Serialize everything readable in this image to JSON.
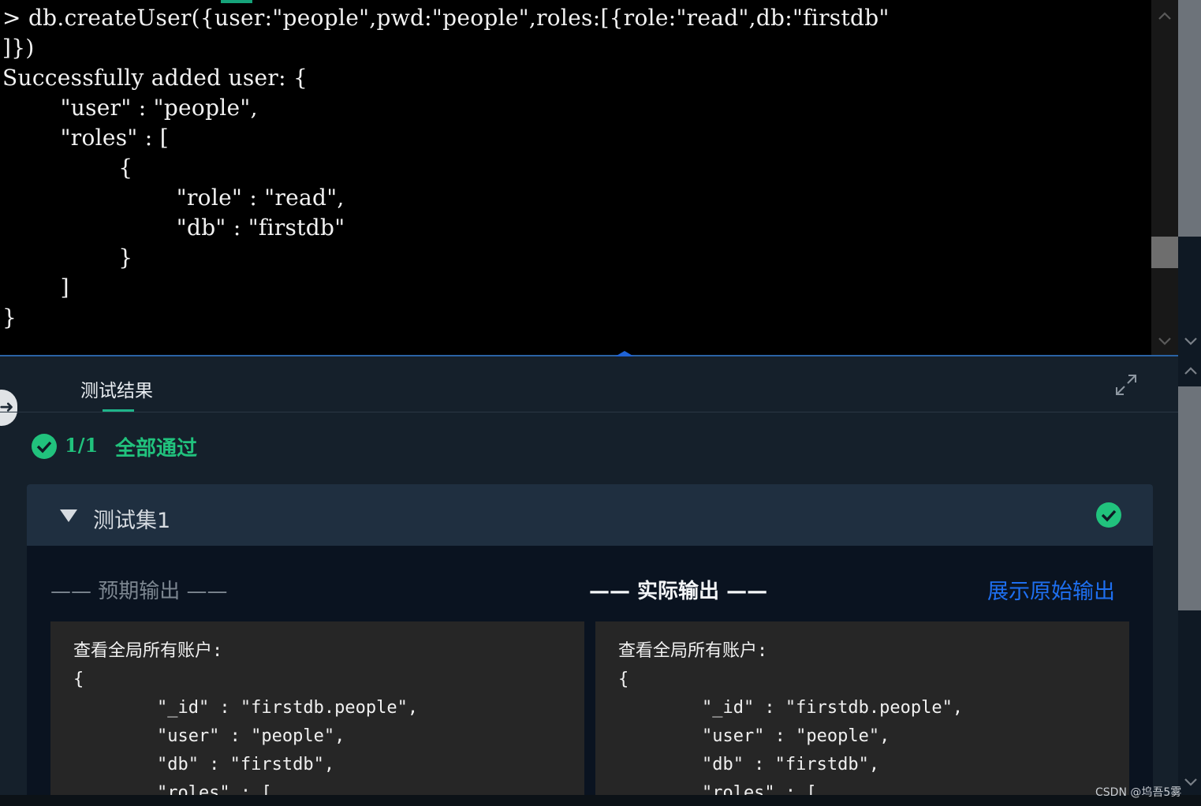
{
  "terminal": {
    "lines": [
      "> db.createUser({user:\"people\",pwd:\"people\",roles:[{role:\"read\",db:\"firstdb\"",
      "]})",
      "Successfully added user: {",
      "        \"user\" : \"people\",",
      "        \"roles\" : [",
      "                {",
      "                        \"role\" : \"read\",",
      "                        \"db\" : \"firstdb\"",
      "                }",
      "        ]",
      "}"
    ]
  },
  "results": {
    "tab_label": "测试结果",
    "summary": {
      "count": "1/1",
      "status": "全部通过"
    },
    "suite": {
      "title": "测试集1",
      "expected_label": "—— 预期输出 ——",
      "actual_label": "—— 实际输出 ——",
      "raw_output_link": "展示原始输出",
      "expected_lines": [
        "查看全局所有账户:",
        "{",
        "        \"_id\" : \"firstdb.people\",",
        "        \"user\" : \"people\",",
        "        \"db\" : \"firstdb\",",
        "        \"roles\" : ["
      ],
      "actual_lines": [
        "查看全局所有账户:",
        "{",
        "        \"_id\" : \"firstdb.people\",",
        "        \"user\" : \"people\",",
        "        \"db\" : \"firstdb\",",
        "        \"roles\" : ["
      ]
    }
  },
  "watermark": "CSDN @坞吾5雾",
  "colors": {
    "success": "#21c27d",
    "link": "#1e6ff0",
    "terminal_bg": "#000000",
    "panel_bg": "#15202b"
  },
  "icons": [
    "check-circle-icon",
    "caret-down-icon",
    "expand-icon",
    "splitter-handle-icon",
    "chevron-up-icon",
    "chevron-down-icon",
    "exit-arrow-icon"
  ]
}
